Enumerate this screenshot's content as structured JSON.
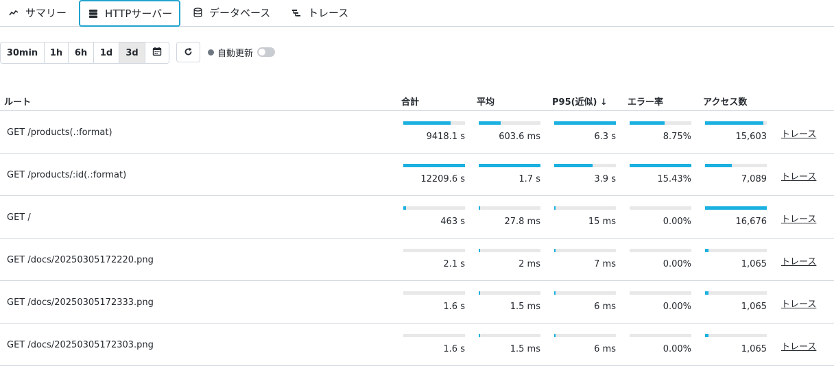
{
  "tabs": [
    {
      "label": "サマリー",
      "icon": "trend-line-icon"
    },
    {
      "label": "HTTPサーバー",
      "icon": "server-icon",
      "active": true
    },
    {
      "label": "データベース",
      "icon": "database-icon"
    },
    {
      "label": "トレース",
      "icon": "trace-tree-icon"
    }
  ],
  "toolbar": {
    "ranges": [
      "30min",
      "1h",
      "6h",
      "1d",
      "3d"
    ],
    "selected_range": "3d",
    "calendar_icon": "calendar-icon",
    "refresh_icon": "refresh-icon",
    "auto_refresh_label": "自動更新",
    "auto_refresh_on": false
  },
  "table": {
    "headers": {
      "route": "ルート",
      "total": "合計",
      "avg": "平均",
      "p95": "P95(近似) ↓",
      "error_rate": "エラー率",
      "access": "アクセス数"
    },
    "trace_link": "トレース",
    "rows": [
      {
        "route": "GET /products(.:format)",
        "total": "9418.1 s",
        "avg": "603.6 ms",
        "p95": "6.3 s",
        "error_rate": "8.75%",
        "access": "15,603",
        "bars": {
          "total": 0.77,
          "avg": 0.35,
          "p95": 1.0,
          "error_rate": 0.57,
          "access": 0.94
        }
      },
      {
        "route": "GET /products/:id(.:format)",
        "total": "12209.6 s",
        "avg": "1.7 s",
        "p95": "3.9 s",
        "error_rate": "15.43%",
        "access": "7,089",
        "bars": {
          "total": 1.0,
          "avg": 1.0,
          "p95": 0.62,
          "error_rate": 1.0,
          "access": 0.43
        }
      },
      {
        "route": "GET /",
        "total": "463 s",
        "avg": "27.8 ms",
        "p95": "15 ms",
        "error_rate": "0.00%",
        "access": "16,676",
        "bars": {
          "total": 0.04,
          "avg": 0.02,
          "p95": 0.01,
          "error_rate": 0.0,
          "access": 1.0
        }
      },
      {
        "route": "GET /docs/20250305172220.png",
        "total": "2.1 s",
        "avg": "2 ms",
        "p95": "7 ms",
        "error_rate": "0.00%",
        "access": "1,065",
        "bars": {
          "total": 0.0,
          "avg": 0.01,
          "p95": 0.01,
          "error_rate": 0.0,
          "access": 0.06
        }
      },
      {
        "route": "GET /docs/20250305172333.png",
        "total": "1.6 s",
        "avg": "1.5 ms",
        "p95": "6 ms",
        "error_rate": "0.00%",
        "access": "1,065",
        "bars": {
          "total": 0.0,
          "avg": 0.01,
          "p95": 0.01,
          "error_rate": 0.0,
          "access": 0.06
        }
      },
      {
        "route": "GET /docs/20250305172303.png",
        "total": "1.6 s",
        "avg": "1.5 ms",
        "p95": "6 ms",
        "error_rate": "0.00%",
        "access": "1,065",
        "bars": {
          "total": 0.0,
          "avg": 0.01,
          "p95": 0.01,
          "error_rate": 0.0,
          "access": 0.06
        }
      }
    ]
  }
}
